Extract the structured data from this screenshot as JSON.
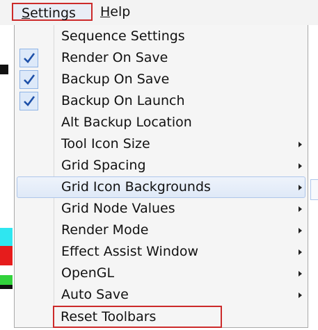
{
  "menubar": {
    "settings_mnemonic": "S",
    "settings_rest": "ettings",
    "help_mnemonic": "H",
    "help_rest": "elp"
  },
  "menu": {
    "items": [
      {
        "label": "Sequence Settings",
        "checked": false,
        "submenu": false
      },
      {
        "label": "Render On Save",
        "checked": true,
        "submenu": false
      },
      {
        "label": "Backup On Save",
        "checked": true,
        "submenu": false
      },
      {
        "label": "Backup On Launch",
        "checked": true,
        "submenu": false
      },
      {
        "label": "Alt Backup Location",
        "checked": false,
        "submenu": false
      },
      {
        "label": "Tool Icon Size",
        "checked": false,
        "submenu": true
      },
      {
        "label": "Grid Spacing",
        "checked": false,
        "submenu": true
      },
      {
        "label": "Grid Icon Backgrounds",
        "checked": false,
        "submenu": true,
        "highlighted": true
      },
      {
        "label": "Grid Node Values",
        "checked": false,
        "submenu": true
      },
      {
        "label": "Render Mode",
        "checked": false,
        "submenu": true
      },
      {
        "label": "Effect Assist Window",
        "checked": false,
        "submenu": true
      },
      {
        "label": "OpenGL",
        "checked": false,
        "submenu": true
      },
      {
        "label": "Auto Save",
        "checked": false,
        "submenu": true
      },
      {
        "label": "Reset Toolbars",
        "checked": false,
        "submenu": false
      }
    ]
  },
  "colors": {
    "highlight_box": "#cc2a2a",
    "check_mark": "#1c4fa8",
    "hover_border": "#aec6ea"
  }
}
